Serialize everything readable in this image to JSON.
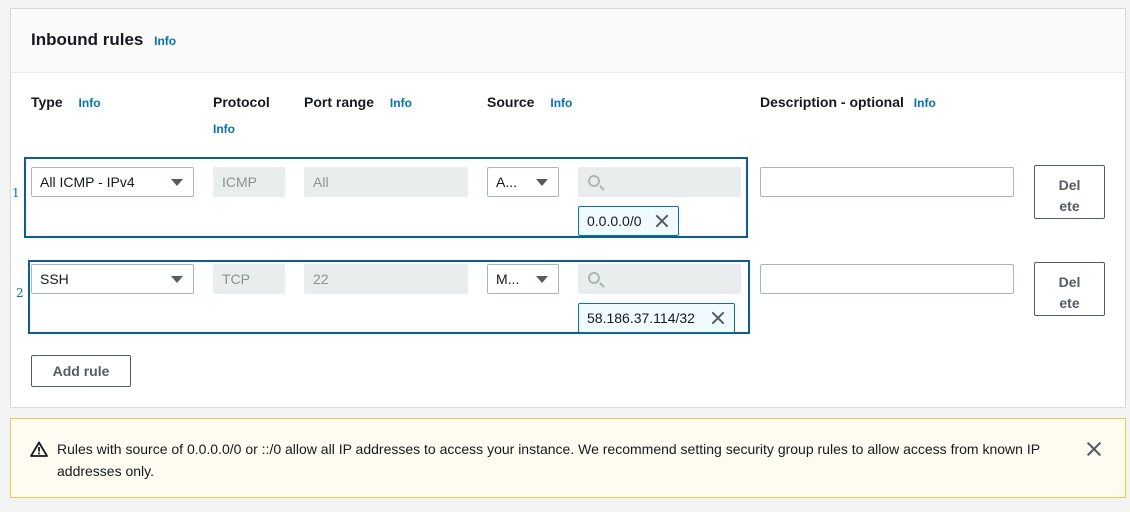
{
  "panel": {
    "title": "Inbound rules",
    "title_info": "Info"
  },
  "columns": {
    "type": "Type",
    "type_info": "Info",
    "protocol": "Protocol",
    "protocol_info": "Info",
    "port_range": "Port range",
    "port_range_info": "Info",
    "source": "Source",
    "source_info": "Info",
    "description": "Description - optional",
    "description_info": "Info"
  },
  "rules": [
    {
      "number": "1",
      "type": "All ICMP - IPv4",
      "protocol": "ICMP",
      "port_range": "All",
      "source_type": "A...",
      "source_token": "0.0.0.0/0",
      "description": "",
      "delete_label_line1": "Del",
      "delete_label_line2": "ete"
    },
    {
      "number": "2",
      "type": "SSH",
      "protocol": "TCP",
      "port_range": "22",
      "source_type": "M...",
      "source_token": "58.186.37.114/32",
      "description": "",
      "delete_label_line1": "Del",
      "delete_label_line2": "ete"
    }
  ],
  "add_rule_label": "Add rule",
  "alert": {
    "message": "Rules with source of 0.0.0.0/0 or ::/0 allow all IP addresses to access your instance. We recommend setting security group rules to allow access from known IP addresses only.",
    "icon": "warning-icon"
  },
  "colors": {
    "accent": "#0073bb",
    "row_highlight": "#0a5e96",
    "alert_bg": "#fefcf0",
    "alert_border": "#f2c94c"
  }
}
